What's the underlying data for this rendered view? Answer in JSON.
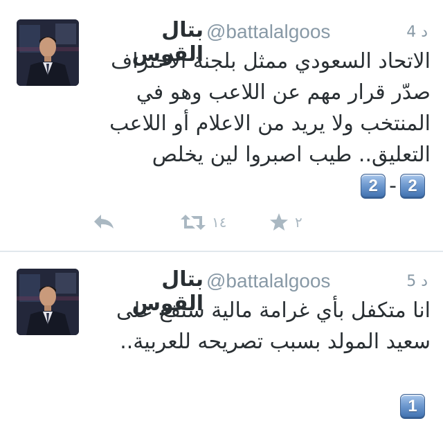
{
  "tweets": [
    {
      "display_name": "بتال القوس",
      "handle": "@battalalgoos",
      "time": "4 د",
      "lines": [
        "الاتحاد السعودي ممثل بلجنة الاحتراف",
        "صدّر قرار مهم عن اللاعب وهو في",
        "المنتخب ولا يريد من الاعلام أو اللاعب",
        "التعليق.. طيب اصبروا لين يخلص"
      ],
      "emoji": {
        "left_key": "2",
        "separator": "-",
        "right_key": "2"
      },
      "actions": {
        "reply_icon": "reply-icon",
        "retweet_icon": "retweet-icon",
        "retweet_count": "١٤",
        "favorite_icon": "star-icon",
        "favorite_count": "٢"
      }
    },
    {
      "display_name": "بتال القوس",
      "handle": "@battalalgoos",
      "time": "5 د",
      "lines": [
        "انا متكفل بأي غرامة مالية ستقع على",
        "سعيد المولد بسبب تصريحه للعربية.."
      ],
      "emoji": {
        "key": "1"
      }
    }
  ],
  "colors": {
    "text": "#292f33",
    "muted": "#8899a6",
    "action_gray": "#aab8c2",
    "divider": "#e1e8ed",
    "keycap_blue": "#6f9ad0"
  }
}
